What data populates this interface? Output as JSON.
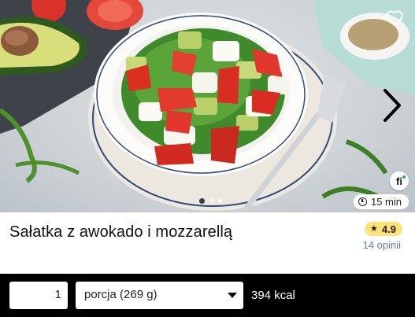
{
  "photo": {
    "duration": "15 min",
    "brand_badge": "fi",
    "carousel": {
      "count": 3,
      "active": 0
    }
  },
  "icons": {
    "favorite": "heart-outline-icon",
    "next": "chevron-right-icon",
    "time": "clock-icon",
    "rating": "star-icon"
  },
  "recipe": {
    "title": "Sałatka z awokado i mozzarellą",
    "rating": "4.9",
    "reviews": "14 opinii"
  },
  "serving_bar": {
    "quantity": "1",
    "portion": "porcja (269 g)",
    "kcal": "394 kcal"
  },
  "colors": {
    "rating_pill": "#ffe27a",
    "reviews_link": "#5f7f9e",
    "bar_bg": "#000000"
  }
}
